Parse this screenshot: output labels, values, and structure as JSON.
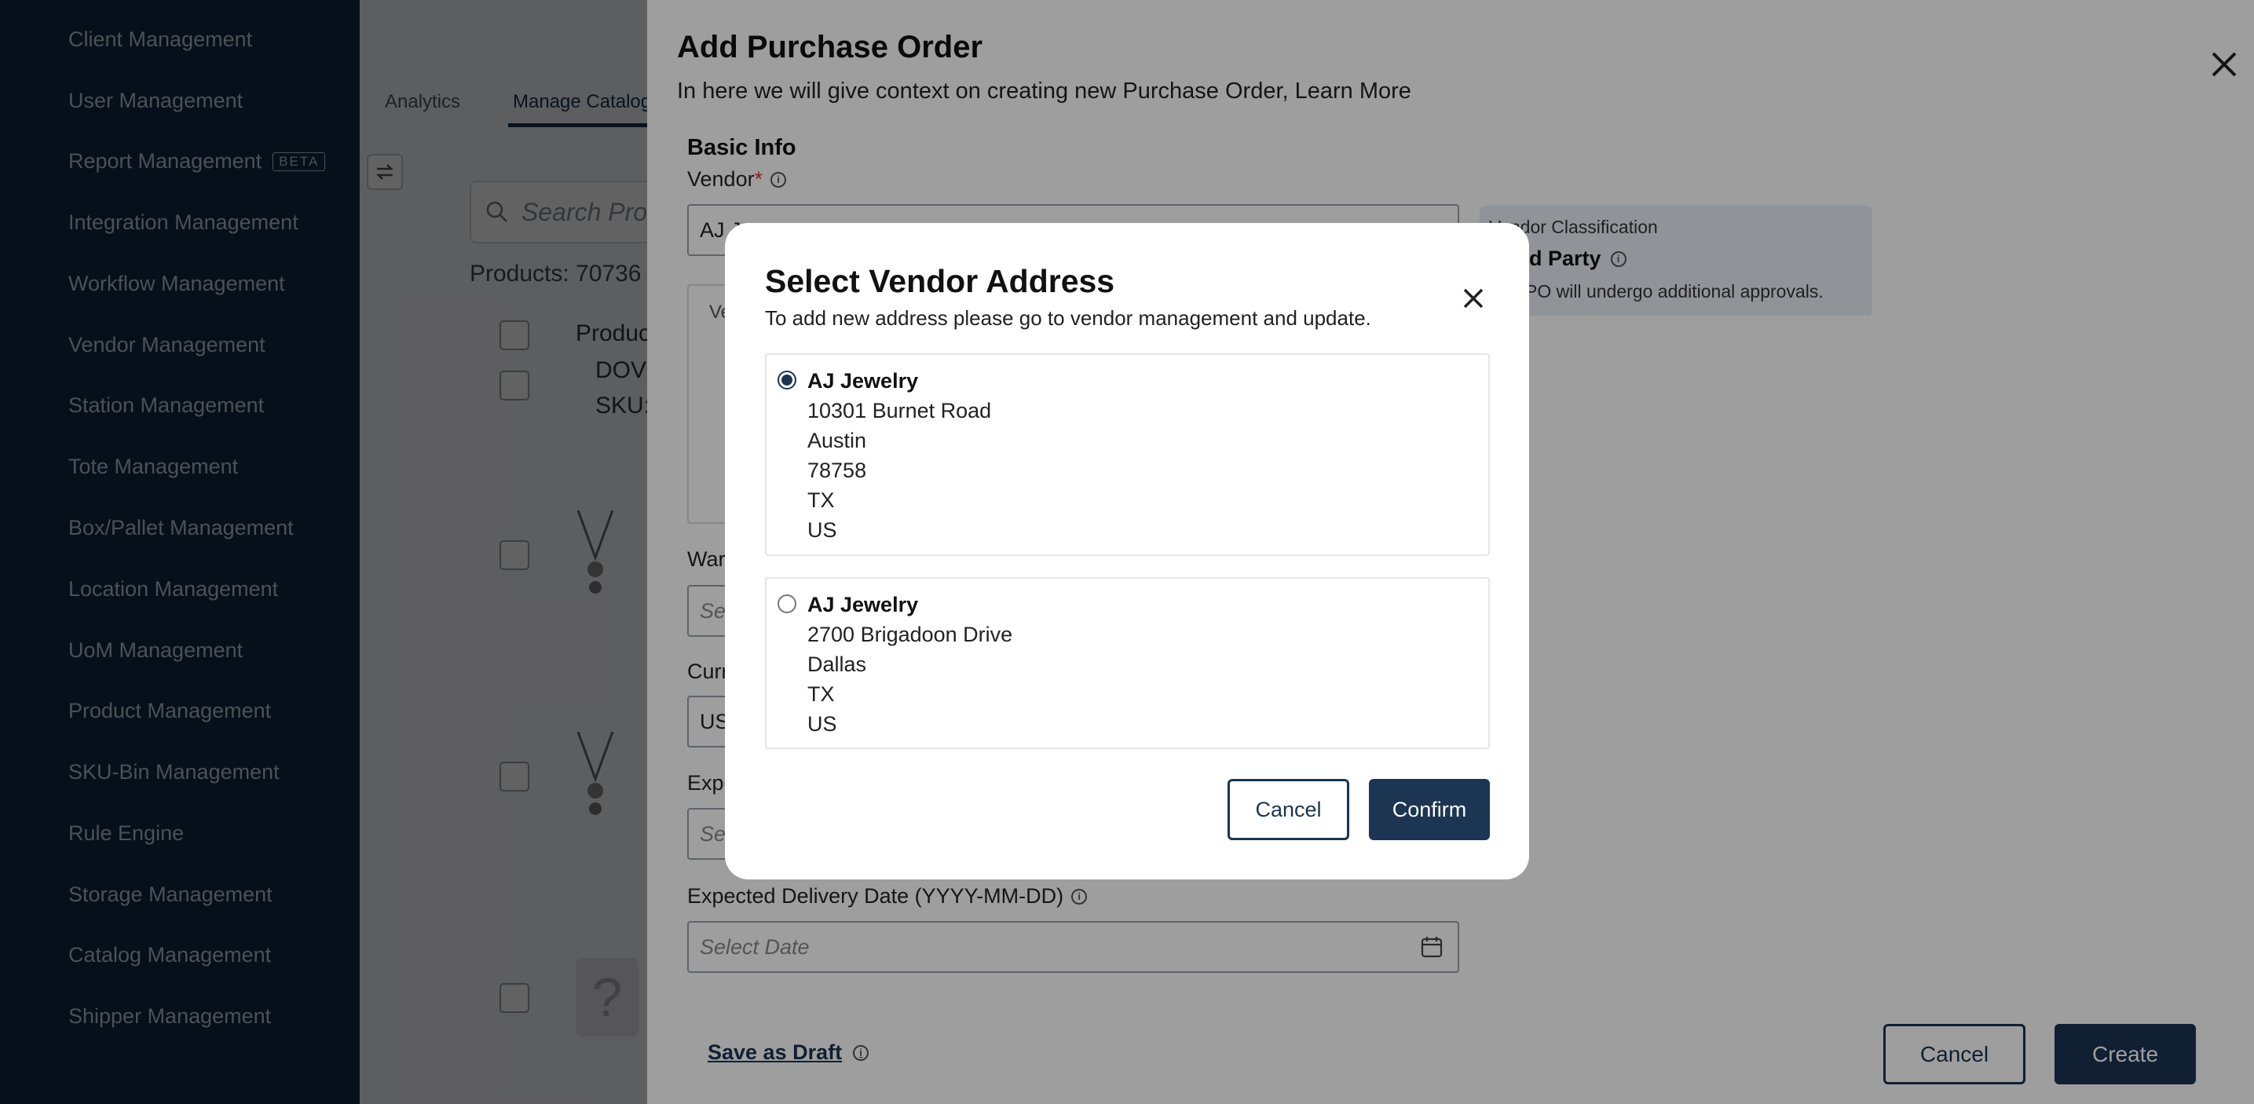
{
  "sidebar": {
    "items": [
      {
        "label": "Client Management"
      },
      {
        "label": "User Management"
      },
      {
        "label": "Report Management",
        "badge": "BETA"
      },
      {
        "label": "Integration Management"
      },
      {
        "label": "Workflow Management"
      },
      {
        "label": "Vendor Management"
      },
      {
        "label": "Station Management"
      },
      {
        "label": "Tote Management"
      },
      {
        "label": "Box/Pallet Management"
      },
      {
        "label": "Location Management"
      },
      {
        "label": "UoM Management"
      },
      {
        "label": "Product Management"
      },
      {
        "label": "SKU-Bin Management"
      },
      {
        "label": "Rule Engine"
      },
      {
        "label": "Storage Management"
      },
      {
        "label": "Catalog Management"
      },
      {
        "label": "Shipper Management"
      }
    ]
  },
  "page": {
    "tabs": [
      {
        "label": "Analytics"
      },
      {
        "label": "Manage Catalog"
      }
    ],
    "search_placeholder": "Search Produ",
    "products_count": "Products: 70736",
    "column_header": "Produc",
    "row1_line1": "DOV",
    "row1_line2": "SKU:"
  },
  "drawer": {
    "title": "Add Purchase Order",
    "subtitle": "In here we will give context on creating new Purchase Order, Learn More",
    "section_title": "Basic Info",
    "vendor_label": "Vendor",
    "vendor_required": "*",
    "vendor_value": "AJ J",
    "vendor_address_label": "Ve",
    "vendor_classification": {
      "title": "Vendor Classification",
      "value": "Third Party",
      "note": "The PO will undergo additional approvals."
    },
    "warehouse_label": "War",
    "warehouse_placeholder": "Sel",
    "currency_label": "Curr",
    "currency_value": "US",
    "expected_label": "Expe",
    "expected_placeholder": "Sel",
    "delivery_date_label": "Expected Delivery Date (YYYY-MM-DD)",
    "delivery_date_placeholder": "Select Date",
    "save_draft_label": "Save as Draft",
    "cancel_label": "Cancel",
    "create_label": "Create"
  },
  "modal": {
    "title": "Select Vendor Address",
    "subtitle": "To add new address please go to vendor management and update.",
    "addresses": [
      {
        "name": "AJ Jewelry",
        "line1": "10301 Burnet Road",
        "line2": "Austin",
        "line3": "78758",
        "line4": "TX",
        "line5": "US",
        "selected": true
      },
      {
        "name": "AJ Jewelry",
        "line1": "2700 Brigadoon Drive",
        "line2": "Dallas",
        "line3": "TX",
        "line4": "US",
        "selected": false
      }
    ],
    "cancel_label": "Cancel",
    "confirm_label": "Confirm"
  },
  "colors": {
    "sidebar_bg": "#0f2a47",
    "primary": "#1b3552",
    "required": "#d0343c",
    "overlay": "rgba(0,0,0,0.38)"
  }
}
